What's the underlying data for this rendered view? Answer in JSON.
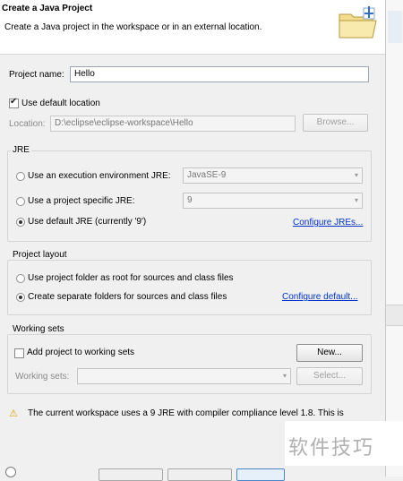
{
  "header": {
    "title": "Create a Java Project",
    "subtitle": "Create a Java project in the workspace or in an external location.",
    "icon": "new-java-project-folder-icon"
  },
  "project": {
    "name_label": "Project name:",
    "name_value": "Hello",
    "use_default_location_label": "Use default location",
    "use_default_location_checked": true,
    "location_label": "Location:",
    "location_value": "D:\\eclipse\\eclipse-workspace\\Hello",
    "browse_label": "Browse..."
  },
  "jre": {
    "group_label": "JRE",
    "exec_env_label": "Use an execution environment JRE:",
    "exec_env_value": "JavaSE-9",
    "specific_label": "Use a project specific JRE:",
    "specific_value": "9",
    "default_label": "Use default JRE (currently '9')",
    "configure_link": "Configure JREs..."
  },
  "layout": {
    "group_label": "Project layout",
    "root_label": "Use project folder as root for sources and class files",
    "separate_label": "Create separate folders for sources and class files",
    "configure_link": "Configure default..."
  },
  "working_sets": {
    "group_label": "Working sets",
    "add_label": "Add project to working sets",
    "new_button": "New...",
    "sets_label": "Working sets:",
    "select_button": "Select..."
  },
  "warning": {
    "text": "The current workspace uses a 9 JRE with compiler compliance level 1.8. This is"
  },
  "watermark": {
    "text": "软件技巧"
  },
  "colors": {
    "link": "#0033cc",
    "warning_icon": "#d8a000"
  }
}
